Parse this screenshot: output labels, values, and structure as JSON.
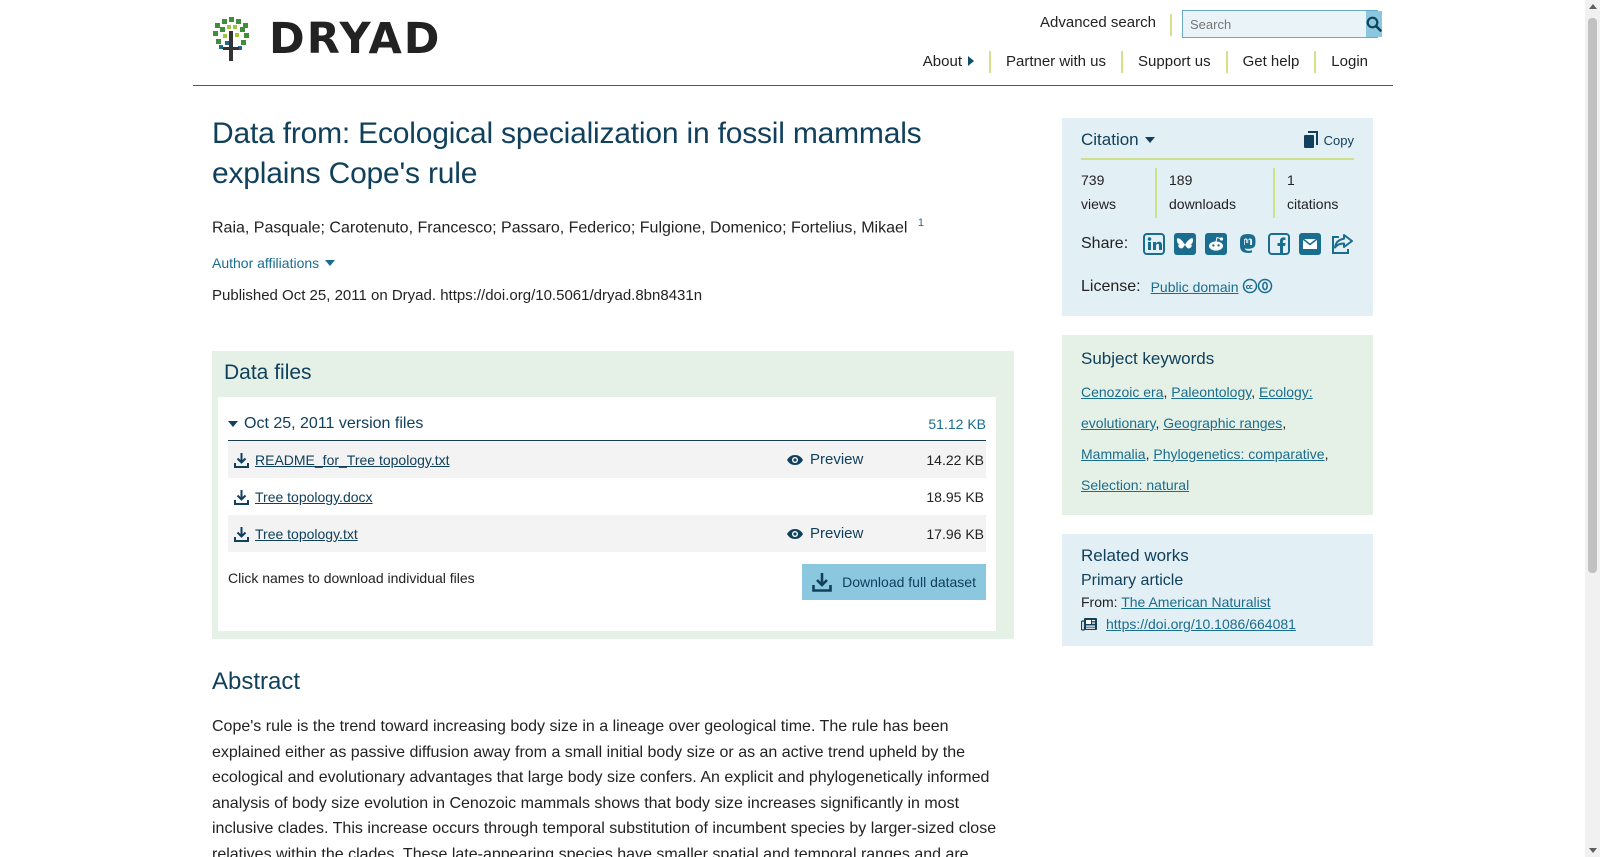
{
  "header": {
    "logo_text": "DRYAD",
    "advanced_search": "Advanced search",
    "search_placeholder": "Search",
    "nav": [
      {
        "label": "About"
      },
      {
        "label": "Partner with us"
      },
      {
        "label": "Support us"
      },
      {
        "label": "Get help"
      },
      {
        "label": "Login"
      }
    ]
  },
  "dataset": {
    "title": "Data from: Ecological specialization in fossil mammals explains Cope's rule",
    "authors": "Raia, Pasquale; Carotenuto, Francesco; Passaro, Federico; Fulgione, Domenico; Fortelius, Mikael",
    "author_sup": "1",
    "affiliations_label": "Author affiliations",
    "published": "Published Oct 25, 2011 on Dryad. https://doi.org/10.5061/dryad.8bn8431n"
  },
  "data_files": {
    "heading": "Data files",
    "version_label": "Oct 25, 2011 version files",
    "version_size": "51.12 KB",
    "files": [
      {
        "name": "README_for_Tree topology.txt",
        "preview": "Preview",
        "size": "14.22 KB"
      },
      {
        "name": "Tree topology.docx",
        "preview": "",
        "size": "18.95 KB"
      },
      {
        "name": "Tree topology.txt",
        "preview": "Preview",
        "size": "17.96 KB"
      }
    ],
    "hint": "Click names to download individual files",
    "download_label": "Download full dataset"
  },
  "abstract": {
    "heading": "Abstract",
    "text": "Cope's rule is the trend toward increasing body size in a lineage over geological time. The rule has been explained either as passive diffusion away from a small initial body size or as an active trend upheld by the ecological and evolutionary advantages that large body size confers. An explicit and phylogenetically informed analysis of body size evolution in Cenozoic mammals shows that body size increases significantly in most inclusive clades. This increase occurs through temporal substitution of incumbent species by larger-sized close relatives within the clades. These late-appearing species have smaller spatial and temporal ranges and are"
  },
  "sidebar": {
    "citation": {
      "label": "Citation",
      "copy": "Copy",
      "views_num": "739",
      "views_label": "views",
      "downloads_num": "189",
      "downloads_label": "downloads",
      "citations_num": "1",
      "citations_label": "citations",
      "share_label": "Share:",
      "share_icons": [
        "linkedin-icon",
        "bluesky-icon",
        "reddit-icon",
        "mastodon-icon",
        "facebook-icon",
        "email-icon",
        "share-icon"
      ],
      "license_label": "License:",
      "license_value": "Public domain",
      "license_badge": "cc0"
    },
    "keywords": {
      "heading": "Subject keywords",
      "items": [
        "Cenozoic era",
        "Paleontology",
        "Ecology: evolutionary",
        "Geographic ranges",
        "Mammalia",
        "Phylogenetics: comparative",
        "Selection: natural"
      ]
    },
    "related": {
      "heading": "Related works",
      "sub": "Primary article",
      "from_label": "From:",
      "from_value": "The American Naturalist",
      "doi": "https://doi.org/10.1086/664081"
    }
  },
  "colors": {
    "brand_dark": "#10405c",
    "link": "#1b6d8f",
    "accent_green": "#cfe08a",
    "button_blue": "#8cc7e0",
    "panel_blue": "#e2eff4",
    "panel_green": "#e5f1e6"
  }
}
